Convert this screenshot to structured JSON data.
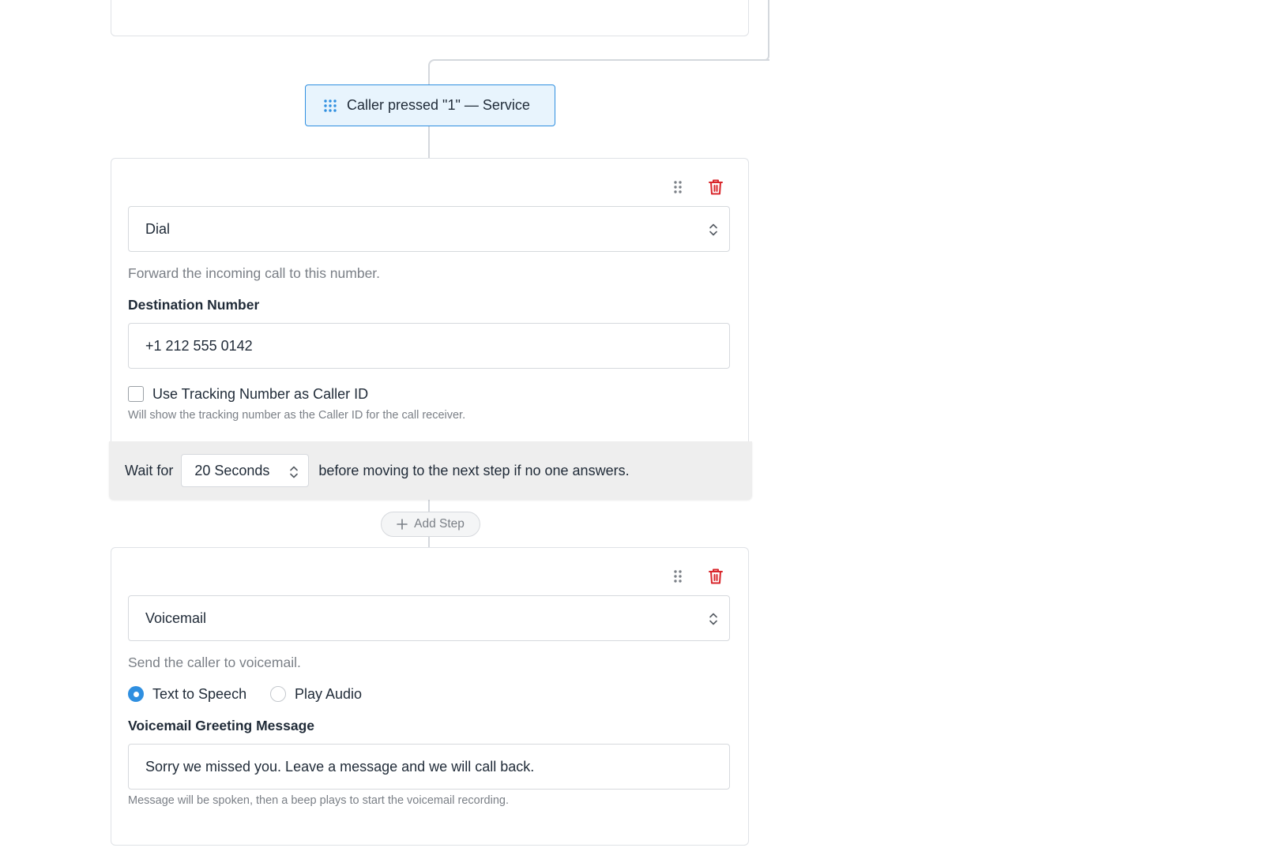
{
  "branch": {
    "label": "Caller pressed \"1\" — Service"
  },
  "dial_step": {
    "action_selected": "Dial",
    "description": "Forward the incoming call to this number.",
    "destination_label": "Destination Number",
    "destination_value": "+1 212 555 0142",
    "caller_id_checkbox_label": "Use Tracking Number as Caller ID",
    "caller_id_checked": false,
    "caller_id_hint": "Will show the tracking number as the Caller ID for the call receiver.",
    "wait_prefix": "Wait for",
    "wait_selected": "20 Seconds",
    "wait_suffix": "before moving to the next step if no one answers."
  },
  "add_step": {
    "label": "Add Step"
  },
  "voicemail_step": {
    "action_selected": "Voicemail",
    "description": "Send the caller to voicemail.",
    "options": [
      {
        "label": "Text to Speech",
        "selected": true
      },
      {
        "label": "Play Audio",
        "selected": false
      }
    ],
    "greeting_label": "Voicemail Greeting Message",
    "greeting_value": "Sorry we missed you. Leave a message and we will call back.",
    "greeting_hint": "Message will be spoken, then a beep plays to start the voicemail recording."
  },
  "colors": {
    "accent": "#2f8fe0",
    "delete": "#d9262b",
    "node_bg": "#e8f4fd"
  },
  "icons": {
    "node": "grip-dots-icon",
    "drag": "drag-handle-icon",
    "delete": "trash-icon",
    "select": "chevron-up-down-icon",
    "add": "plus-icon"
  }
}
